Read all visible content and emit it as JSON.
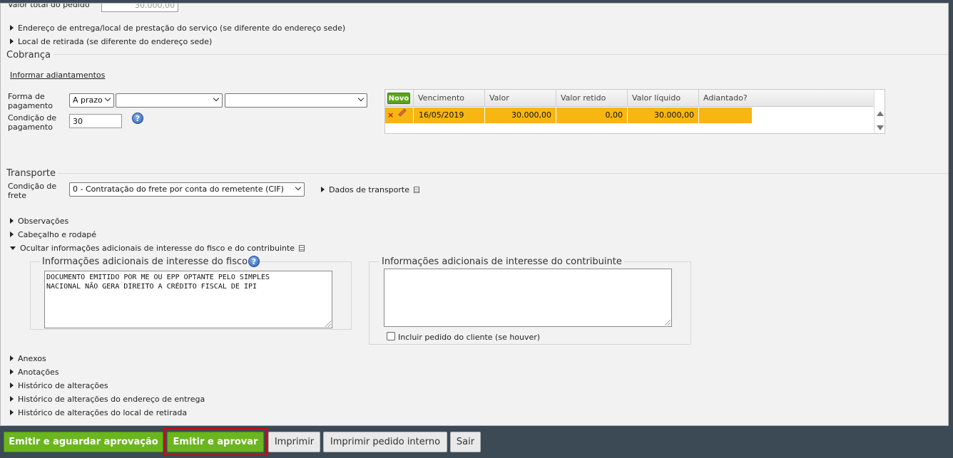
{
  "top_field": {
    "label": "Valor total do pedido",
    "value": "30.000,00"
  },
  "expanders_top": [
    "Endereço de entrega/local de prestação do serviço (se diferente do endereço sede)",
    "Local de retirada (se diferente do endereço sede)"
  ],
  "cobranca": {
    "title": "Cobrança",
    "link_adiantamentos": "Informar adiantamentos",
    "forma_label": "Forma de pagamento",
    "forma_value": "A prazo",
    "forma_value2": "",
    "forma_value3": "",
    "condicao_label": "Condição de pagamento",
    "condicao_value": "30"
  },
  "grid": {
    "novo_label": "Novo",
    "headers": [
      "Vencimento",
      "Valor",
      "Valor retido",
      "Valor líquido",
      "Adiantado?"
    ],
    "rows": [
      {
        "vencimento": "16/05/2019",
        "valor": "30.000,00",
        "valor_retido": "0,00",
        "valor_liquido": "30.000,00",
        "adiantado": ""
      }
    ]
  },
  "transporte": {
    "title": "Transporte",
    "condicao_frete_label": "Condição de frete",
    "condicao_frete_value": "0 - Contratação do frete por conta do remetente (CIF)",
    "dados_transporte": "Dados de transporte"
  },
  "expanders_mid": [
    "Observações",
    "Cabeçalho e rodapé"
  ],
  "ocultar_label": "Ocultar informações adicionais de interesse do fisco e do contribuinte",
  "fisco": {
    "legend": "Informações adicionais de interesse do fisco",
    "text": "DOCUMENTO EMITIDO POR ME OU EPP OPTANTE PELO SIMPLES\nNACIONAL NÃO GERA DIREITO A CRÉDITO FISCAL DE IPI"
  },
  "contribuinte": {
    "legend": "Informações adicionais de interesse do contribuinte",
    "text": "",
    "checkbox_label": "Incluir pedido do cliente (se houver)",
    "checked": false
  },
  "expanders_bottom": [
    "Anexos",
    "Anotações",
    "Histórico de alterações",
    "Histórico de alterações do endereço de entrega",
    "Histórico de alterações do local de retirada"
  ],
  "buttons": {
    "emitir_aguardar": "Emitir e aguardar aprovação",
    "emitir_aprovar": "Emitir e aprovar",
    "imprimir": "Imprimir",
    "imprimir_interno": "Imprimir pedido interno",
    "sair": "Sair"
  },
  "colors": {
    "accent_green": "#6bb51f",
    "row_highlight": "#f7b611",
    "highlight_border": "#e00000"
  }
}
